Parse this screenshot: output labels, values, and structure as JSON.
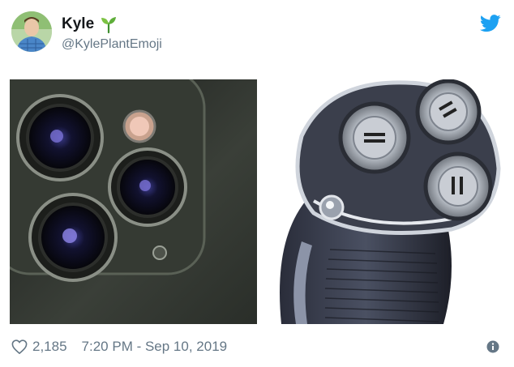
{
  "user": {
    "display_name": "Kyle",
    "handle": "@KylePlantEmoji"
  },
  "icons": {
    "name_emoji": "seedling-icon",
    "brand": "twitter-bird-icon",
    "like": "heart-icon",
    "info": "info-icon"
  },
  "media": {
    "left_image": "camera-lenses-photo",
    "right_image": "electric-shaver-photo"
  },
  "footer": {
    "likes": "2,185",
    "timestamp": "7:20 PM - Sep 10, 2019"
  },
  "colors": {
    "twitter_blue": "#1da1f2",
    "secondary_text": "#657786",
    "primary_text": "#14171a"
  }
}
